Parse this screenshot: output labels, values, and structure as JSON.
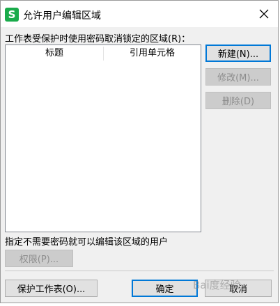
{
  "window": {
    "title": "允许用户编辑区域",
    "app_icon_letter": "S",
    "app_icon_color": "#1aab4b"
  },
  "ranges": {
    "label": "工作表受保护时使用密码取消锁定的区域(R)：",
    "columns": [
      "标题",
      "引用单元格"
    ],
    "rows": []
  },
  "buttons": {
    "new": "新建(N)...",
    "modify": "修改(M)...",
    "delete": "删除(D)",
    "permissions": "权限(P)...",
    "protect_sheet": "保护工作表(O)...",
    "ok": "确定",
    "cancel": "取消"
  },
  "users_label": "指定不需要密码就可以编辑该区域的用户",
  "watermark": "Bai度经验"
}
